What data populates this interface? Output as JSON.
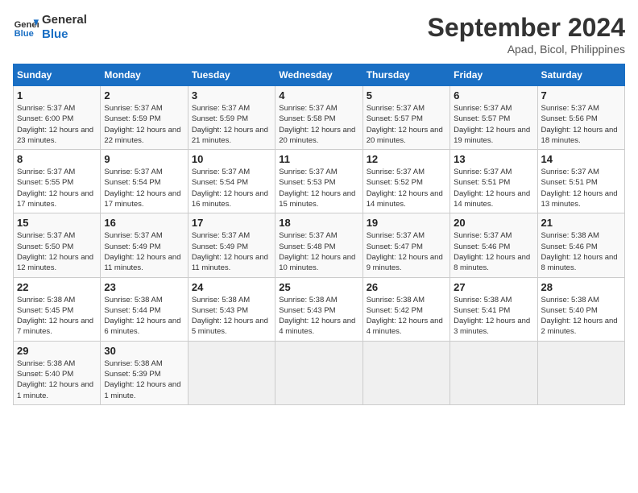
{
  "logo": {
    "line1": "General",
    "line2": "Blue"
  },
  "title": "September 2024",
  "subtitle": "Apad, Bicol, Philippines",
  "headers": [
    "Sunday",
    "Monday",
    "Tuesday",
    "Wednesday",
    "Thursday",
    "Friday",
    "Saturday"
  ],
  "weeks": [
    [
      {
        "day": "1",
        "sunrise": "5:37 AM",
        "sunset": "6:00 PM",
        "daylight": "12 hours and 23 minutes."
      },
      {
        "day": "2",
        "sunrise": "5:37 AM",
        "sunset": "5:59 PM",
        "daylight": "12 hours and 22 minutes."
      },
      {
        "day": "3",
        "sunrise": "5:37 AM",
        "sunset": "5:59 PM",
        "daylight": "12 hours and 21 minutes."
      },
      {
        "day": "4",
        "sunrise": "5:37 AM",
        "sunset": "5:58 PM",
        "daylight": "12 hours and 20 minutes."
      },
      {
        "day": "5",
        "sunrise": "5:37 AM",
        "sunset": "5:57 PM",
        "daylight": "12 hours and 20 minutes."
      },
      {
        "day": "6",
        "sunrise": "5:37 AM",
        "sunset": "5:57 PM",
        "daylight": "12 hours and 19 minutes."
      },
      {
        "day": "7",
        "sunrise": "5:37 AM",
        "sunset": "5:56 PM",
        "daylight": "12 hours and 18 minutes."
      }
    ],
    [
      {
        "day": "8",
        "sunrise": "5:37 AM",
        "sunset": "5:55 PM",
        "daylight": "12 hours and 17 minutes."
      },
      {
        "day": "9",
        "sunrise": "5:37 AM",
        "sunset": "5:54 PM",
        "daylight": "12 hours and 17 minutes."
      },
      {
        "day": "10",
        "sunrise": "5:37 AM",
        "sunset": "5:54 PM",
        "daylight": "12 hours and 16 minutes."
      },
      {
        "day": "11",
        "sunrise": "5:37 AM",
        "sunset": "5:53 PM",
        "daylight": "12 hours and 15 minutes."
      },
      {
        "day": "12",
        "sunrise": "5:37 AM",
        "sunset": "5:52 PM",
        "daylight": "12 hours and 14 minutes."
      },
      {
        "day": "13",
        "sunrise": "5:37 AM",
        "sunset": "5:51 PM",
        "daylight": "12 hours and 14 minutes."
      },
      {
        "day": "14",
        "sunrise": "5:37 AM",
        "sunset": "5:51 PM",
        "daylight": "12 hours and 13 minutes."
      }
    ],
    [
      {
        "day": "15",
        "sunrise": "5:37 AM",
        "sunset": "5:50 PM",
        "daylight": "12 hours and 12 minutes."
      },
      {
        "day": "16",
        "sunrise": "5:37 AM",
        "sunset": "5:49 PM",
        "daylight": "12 hours and 11 minutes."
      },
      {
        "day": "17",
        "sunrise": "5:37 AM",
        "sunset": "5:49 PM",
        "daylight": "12 hours and 11 minutes."
      },
      {
        "day": "18",
        "sunrise": "5:37 AM",
        "sunset": "5:48 PM",
        "daylight": "12 hours and 10 minutes."
      },
      {
        "day": "19",
        "sunrise": "5:37 AM",
        "sunset": "5:47 PM",
        "daylight": "12 hours and 9 minutes."
      },
      {
        "day": "20",
        "sunrise": "5:37 AM",
        "sunset": "5:46 PM",
        "daylight": "12 hours and 8 minutes."
      },
      {
        "day": "21",
        "sunrise": "5:38 AM",
        "sunset": "5:46 PM",
        "daylight": "12 hours and 8 minutes."
      }
    ],
    [
      {
        "day": "22",
        "sunrise": "5:38 AM",
        "sunset": "5:45 PM",
        "daylight": "12 hours and 7 minutes."
      },
      {
        "day": "23",
        "sunrise": "5:38 AM",
        "sunset": "5:44 PM",
        "daylight": "12 hours and 6 minutes."
      },
      {
        "day": "24",
        "sunrise": "5:38 AM",
        "sunset": "5:43 PM",
        "daylight": "12 hours and 5 minutes."
      },
      {
        "day": "25",
        "sunrise": "5:38 AM",
        "sunset": "5:43 PM",
        "daylight": "12 hours and 4 minutes."
      },
      {
        "day": "26",
        "sunrise": "5:38 AM",
        "sunset": "5:42 PM",
        "daylight": "12 hours and 4 minutes."
      },
      {
        "day": "27",
        "sunrise": "5:38 AM",
        "sunset": "5:41 PM",
        "daylight": "12 hours and 3 minutes."
      },
      {
        "day": "28",
        "sunrise": "5:38 AM",
        "sunset": "5:40 PM",
        "daylight": "12 hours and 2 minutes."
      }
    ],
    [
      {
        "day": "29",
        "sunrise": "5:38 AM",
        "sunset": "5:40 PM",
        "daylight": "12 hours and 1 minute."
      },
      {
        "day": "30",
        "sunrise": "5:38 AM",
        "sunset": "5:39 PM",
        "daylight": "12 hours and 1 minute."
      },
      null,
      null,
      null,
      null,
      null
    ]
  ]
}
